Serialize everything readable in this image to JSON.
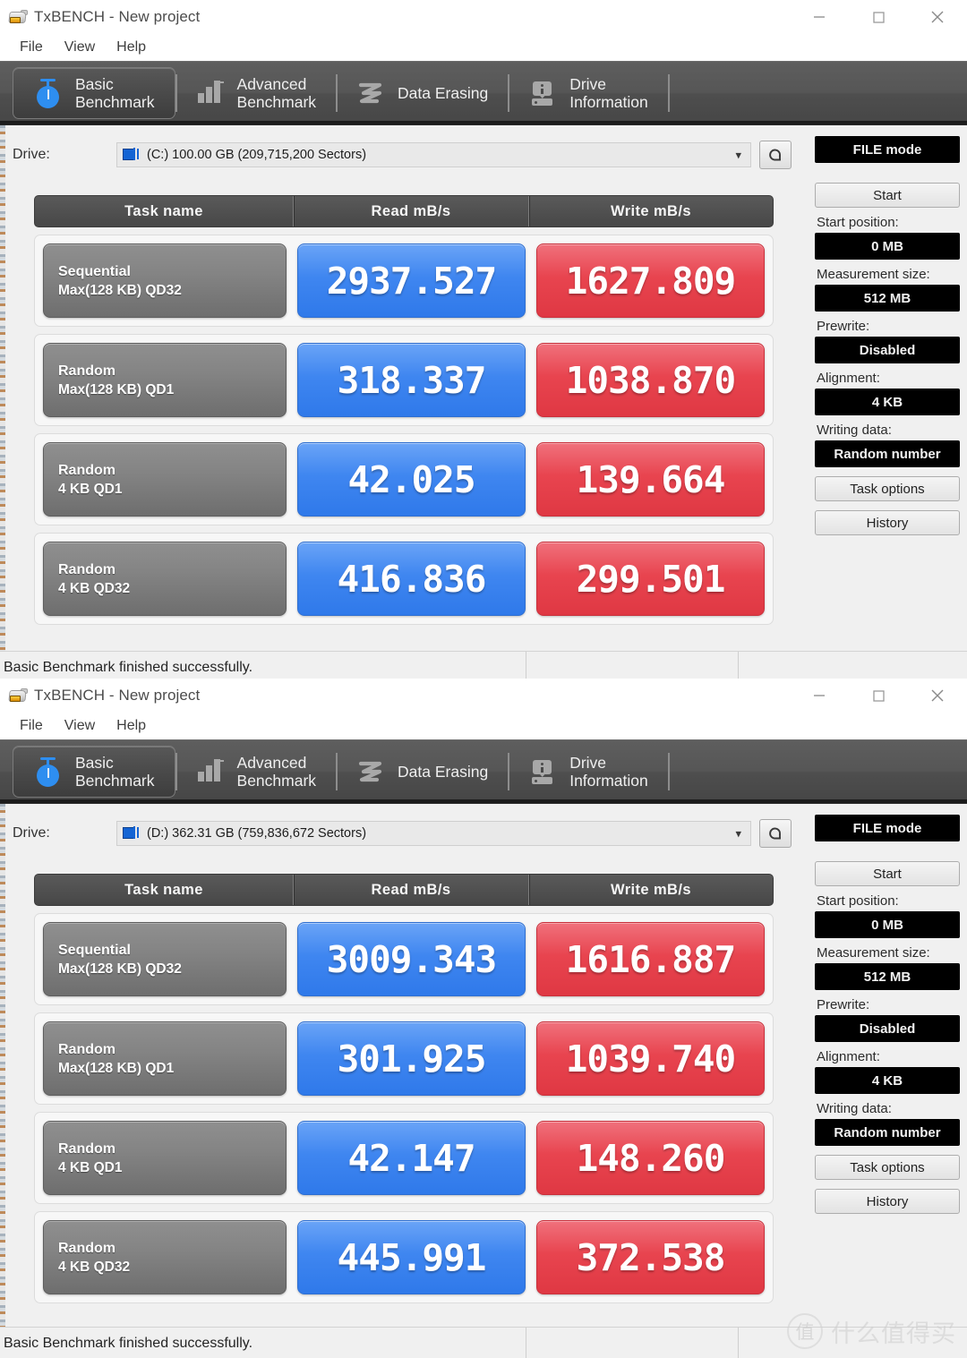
{
  "app": {
    "title": "TxBENCH - New project",
    "icon": "hdd-icon",
    "window_controls": {
      "minimize": "minimize-icon",
      "maximize": "maximize-icon",
      "close": "close-icon"
    }
  },
  "menu": {
    "items": [
      "File",
      "View",
      "Help"
    ]
  },
  "tabs": [
    {
      "id": "basic-benchmark",
      "label": "Basic\nBenchmark",
      "icon": "stopwatch-icon",
      "active": true
    },
    {
      "id": "advanced-benchmark",
      "label": "Advanced\nBenchmark",
      "icon": "bar-chart-icon",
      "active": false
    },
    {
      "id": "data-erasing",
      "label": "Data Erasing",
      "icon": "eraser-wave-icon",
      "active": false
    },
    {
      "id": "drive-information",
      "label": "Drive\nInformation",
      "icon": "drive-info-icon",
      "active": false
    }
  ],
  "drive": {
    "label": "Drive:",
    "refresh_icon": "refresh-icon",
    "dropdown_icon": "chevron-down-icon",
    "drive_icon": "local-disk-icon"
  },
  "table": {
    "headers": {
      "task": "Task name",
      "read": "Read mB/s",
      "write": "Write mB/s"
    }
  },
  "sidebar": {
    "mode_label": "FILE mode",
    "start_label": "Start",
    "start_position_label": "Start position:",
    "start_position_value": "0 MB",
    "measurement_size_label": "Measurement size:",
    "measurement_size_value": "512 MB",
    "prewrite_label": "Prewrite:",
    "prewrite_value": "Disabled",
    "alignment_label": "Alignment:",
    "alignment_value": "4 KB",
    "writing_data_label": "Writing data:",
    "writing_data_value": "Random number",
    "task_options_label": "Task options",
    "history_label": "History"
  },
  "windows": [
    {
      "id": "window-c-drive",
      "drive_value": "(C:)  100.00 GB (209,715,200 Sectors)",
      "status": "Basic Benchmark finished successfully.",
      "rows": [
        {
          "task_line1": "Sequential",
          "task_line2": "Max(128 KB) QD32",
          "read": "2937.527",
          "write": "1627.809"
        },
        {
          "task_line1": "Random",
          "task_line2": "Max(128 KB) QD1",
          "read": "318.337",
          "write": "1038.870"
        },
        {
          "task_line1": "Random",
          "task_line2": "4 KB QD1",
          "read": "42.025",
          "write": "139.664"
        },
        {
          "task_line1": "Random",
          "task_line2": "4 KB QD32",
          "read": "416.836",
          "write": "299.501"
        }
      ]
    },
    {
      "id": "window-d-drive",
      "drive_value": "(D:)  362.31 GB (759,836,672 Sectors)",
      "status": "Basic Benchmark finished successfully.",
      "rows": [
        {
          "task_line1": "Sequential",
          "task_line2": "Max(128 KB) QD32",
          "read": "3009.343",
          "write": "1616.887"
        },
        {
          "task_line1": "Random",
          "task_line2": "Max(128 KB) QD1",
          "read": "301.925",
          "write": "1039.740"
        },
        {
          "task_line1": "Random",
          "task_line2": "4 KB QD1",
          "read": "42.147",
          "write": "148.260"
        },
        {
          "task_line1": "Random",
          "task_line2": "4 KB QD32",
          "read": "445.991",
          "write": "372.538"
        }
      ]
    }
  ],
  "watermark": {
    "mark": "值",
    "text": "什么值得买"
  },
  "colors": {
    "read_blue": "#3f86f0",
    "write_red": "#e8444f",
    "tab_bar": "#4e4e4e",
    "accent_icon_blue": "#2e8ef0"
  }
}
